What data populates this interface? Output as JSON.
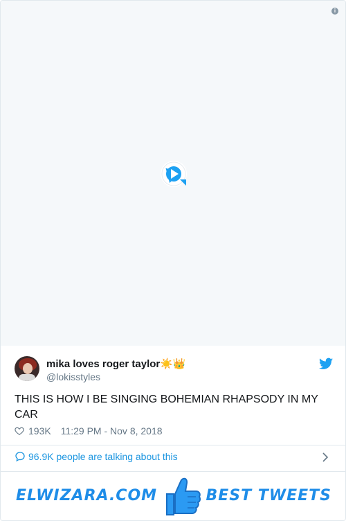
{
  "media": {
    "info_icon": "info-icon",
    "play_icon": "play-icon"
  },
  "tweet": {
    "display_name": "mika loves roger taylor",
    "emojis": "☀️👑",
    "handle": "@lokisstyles",
    "text": "THIS IS HOW I BE SINGING BOHEMIAN RHAPSODY IN MY CAR",
    "likes": "193K",
    "timestamp": "11:29 PM - Nov 8, 2018",
    "talking": "96.9K people are talking about this"
  },
  "banner": {
    "left_text": "ELWIZARA.COM",
    "right_text": "BEST TWEETS"
  },
  "colors": {
    "accent": "#1b95e0",
    "brand": "#1f8de8",
    "muted": "#657786"
  }
}
